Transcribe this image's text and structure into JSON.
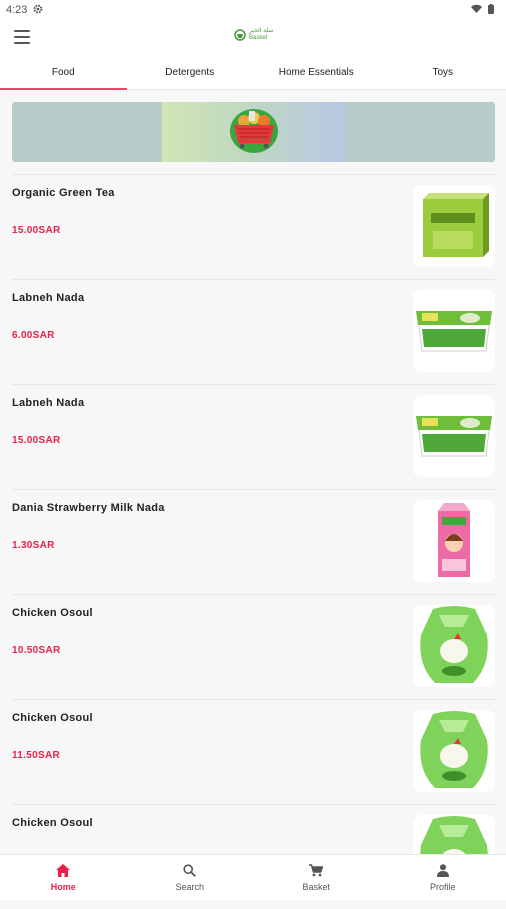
{
  "status_bar": {
    "time": "4:23",
    "settings_icon": "gear-icon",
    "wifi_icon": "wifi-icon",
    "battery_icon": "battery-icon"
  },
  "app_bar": {
    "menu_icon": "hamburger-menu-icon",
    "logo_line1": "سلة الخير",
    "logo_line2": "Basket"
  },
  "tabs": [
    {
      "label": "Food",
      "active": true
    },
    {
      "label": "Detergents",
      "active": false
    },
    {
      "label": "Home Essentials",
      "active": false
    },
    {
      "label": "Toys",
      "active": false
    }
  ],
  "banner": {
    "icon": "shopping-basket-icon"
  },
  "products": [
    {
      "name": "Organic Green Tea",
      "price": "15.00SAR",
      "image": "green-tea-box"
    },
    {
      "name": "Labneh Nada",
      "price": "6.00SAR",
      "image": "labneh-tub"
    },
    {
      "name": "Labneh Nada",
      "price": "15.00SAR",
      "image": "labneh-tub"
    },
    {
      "name": "Dania Strawberry Milk Nada",
      "price": "1.30SAR",
      "image": "milk-carton"
    },
    {
      "name": "Chicken Osoul",
      "price": "10.50SAR",
      "image": "chicken-pack"
    },
    {
      "name": "Chicken Osoul",
      "price": "11.50SAR",
      "image": "chicken-pack"
    },
    {
      "name": "Chicken Osoul",
      "price": "",
      "image": "chicken-pack"
    }
  ],
  "bottom_nav": [
    {
      "label": "Home",
      "icon": "home-icon",
      "active": true
    },
    {
      "label": "Search",
      "icon": "search-icon",
      "active": false
    },
    {
      "label": "Basket",
      "icon": "cart-icon",
      "active": false
    },
    {
      "label": "Profile",
      "icon": "person-icon",
      "active": false
    }
  ],
  "colors": {
    "accent": "#e8204b",
    "tab_indicator": "#e8486a",
    "brand_green": "#4a9d3c"
  }
}
